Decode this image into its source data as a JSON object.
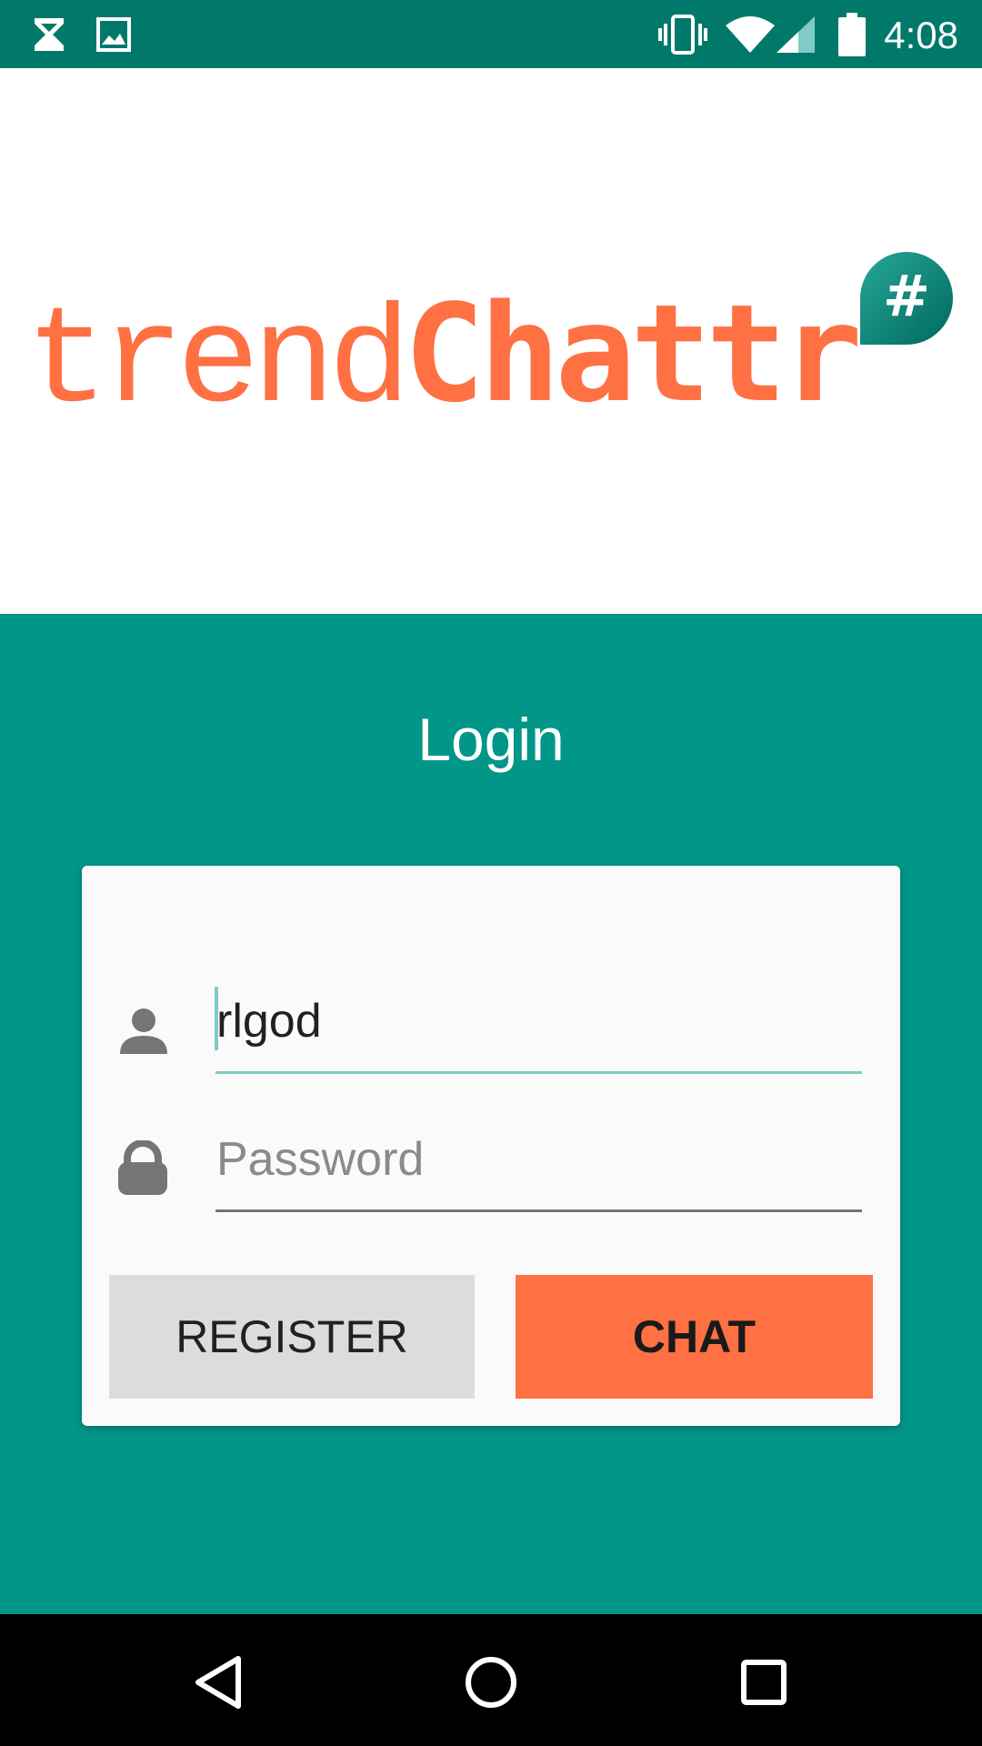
{
  "status_bar": {
    "time": "4:08",
    "left_icons": [
      "hourglass-icon",
      "image-icon"
    ],
    "right_icons": [
      "vibrate-icon",
      "wifi-icon",
      "cell-signal-icon",
      "battery-icon"
    ]
  },
  "logo": {
    "text_part1": "trend",
    "text_part2": "Chattr",
    "badge": "#",
    "colors": {
      "orange": "#ff7043",
      "teal_dark": "#00695c",
      "teal_light": "#26a69a"
    }
  },
  "login": {
    "title": "Login",
    "username_value": "rlgod",
    "password_placeholder": "Password",
    "register_label": "REGISTER",
    "chat_label": "CHAT"
  },
  "colors": {
    "status_bar": "#00796b",
    "background_teal": "#009688",
    "card": "#fafafa",
    "accent": "#ff7043",
    "register_bg": "#dcdcdc"
  },
  "nav_bar": {
    "buttons": [
      "back-icon",
      "home-icon",
      "recents-icon"
    ]
  }
}
